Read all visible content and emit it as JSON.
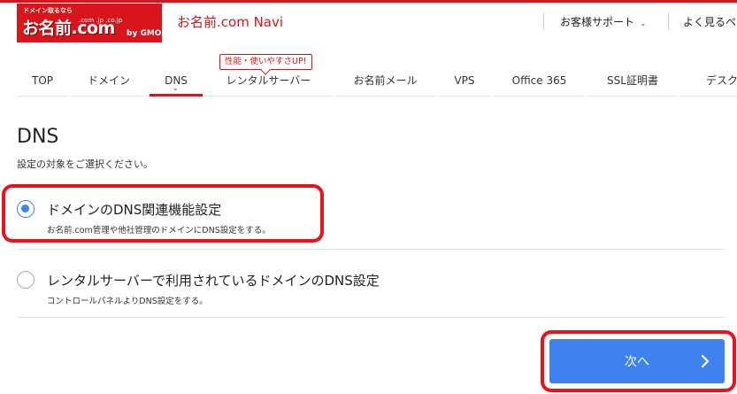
{
  "header": {
    "logo": {
      "tagline": "ドメイン取るなら",
      "domains": ".com .jp .co.jp",
      "brand": "お名前.com",
      "by": "by GMO"
    },
    "title": "お名前.com Navi",
    "support_label": "お客様サポート",
    "faq_label": "よく見るペ"
  },
  "nav": {
    "badge": "性能・使いやすさUP!",
    "items": [
      {
        "label": "TOP"
      },
      {
        "label": "ドメイン"
      },
      {
        "label": "DNS"
      },
      {
        "label": "レンタルサーバー"
      },
      {
        "label": "お名前メール"
      },
      {
        "label": "VPS"
      },
      {
        "label": "Office 365"
      },
      {
        "label": "SSL証明書"
      },
      {
        "label": "デスク"
      }
    ],
    "active_index": 2
  },
  "main": {
    "title": "DNS",
    "subtitle": "設定の対象をご選択ください。",
    "options": [
      {
        "label": "ドメインのDNS関連機能設定",
        "description": "お名前.com管理や他社管理のドメインにDNS設定をする。",
        "selected": true
      },
      {
        "label": "レンタルサーバーで利用されているドメインのDNS設定",
        "description": "コントロールパネルよりDNS設定をする。",
        "selected": false
      }
    ],
    "next_label": "次へ"
  },
  "colors": {
    "brand_red": "#d8151c",
    "accent_blue": "#3e82f0",
    "radio_blue": "#3b82f6",
    "annotation_red": "#e8141b"
  },
  "icons": {
    "support_dropdown": "chevron-down-icon",
    "nav_active_marker": "chevron-down-icon",
    "next_arrow": "chevron-right-icon"
  }
}
